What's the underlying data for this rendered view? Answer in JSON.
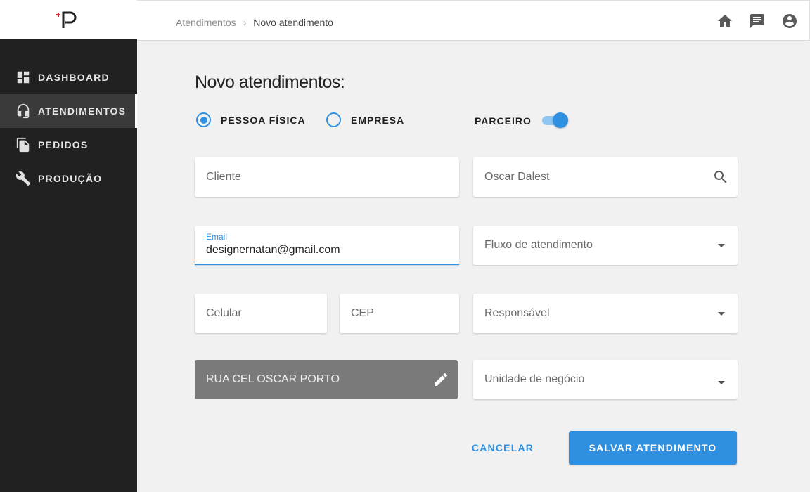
{
  "sidebar": {
    "logo_icon": "logo-p-icon",
    "items": [
      {
        "label": "DASHBOARD",
        "icon": "dashboard-icon",
        "active": false
      },
      {
        "label": "ATENDIMENTOS",
        "icon": "headset-icon",
        "active": true
      },
      {
        "label": "PEDIDOS",
        "icon": "documents-icon",
        "active": false
      },
      {
        "label": "PRODUÇÃO",
        "icon": "wrench-icon",
        "active": false
      }
    ]
  },
  "header": {
    "breadcrumb": {
      "parent": "Atendimentos",
      "separator": "›",
      "current": "Novo atendimento"
    },
    "icons": [
      "home-icon",
      "chat-icon",
      "account-icon"
    ]
  },
  "form": {
    "title": "Novo atendimentos:",
    "person_type": {
      "options": [
        {
          "label": "PESSOA FÍSICA",
          "checked": true
        },
        {
          "label": "EMPRESA",
          "checked": false
        }
      ]
    },
    "partner": {
      "label": "PARCEIRO",
      "enabled": true
    },
    "fields": {
      "cliente": {
        "placeholder": "Cliente"
      },
      "partner_search": {
        "value": "Oscar Dalest",
        "icon": "search-icon"
      },
      "email": {
        "label": "Email",
        "value": "designernatan@gmail.com"
      },
      "fluxo": {
        "placeholder": "Fluxo de atendimento"
      },
      "celular": {
        "placeholder": "Celular"
      },
      "cep": {
        "placeholder": "CEP"
      },
      "responsavel": {
        "placeholder": "Responsável"
      },
      "endereco": {
        "value": "RUA CEL OSCAR PORTO",
        "icon": "pencil-icon"
      },
      "unidade": {
        "placeholder": "Unidade de negócio"
      }
    },
    "actions": {
      "cancel": "CANCELAR",
      "save": "SALVAR ATENDIMENTO"
    }
  },
  "colors": {
    "accent": "#2f8fe0",
    "sidebar_bg": "#212121",
    "page_bg": "#f1f1f1"
  }
}
